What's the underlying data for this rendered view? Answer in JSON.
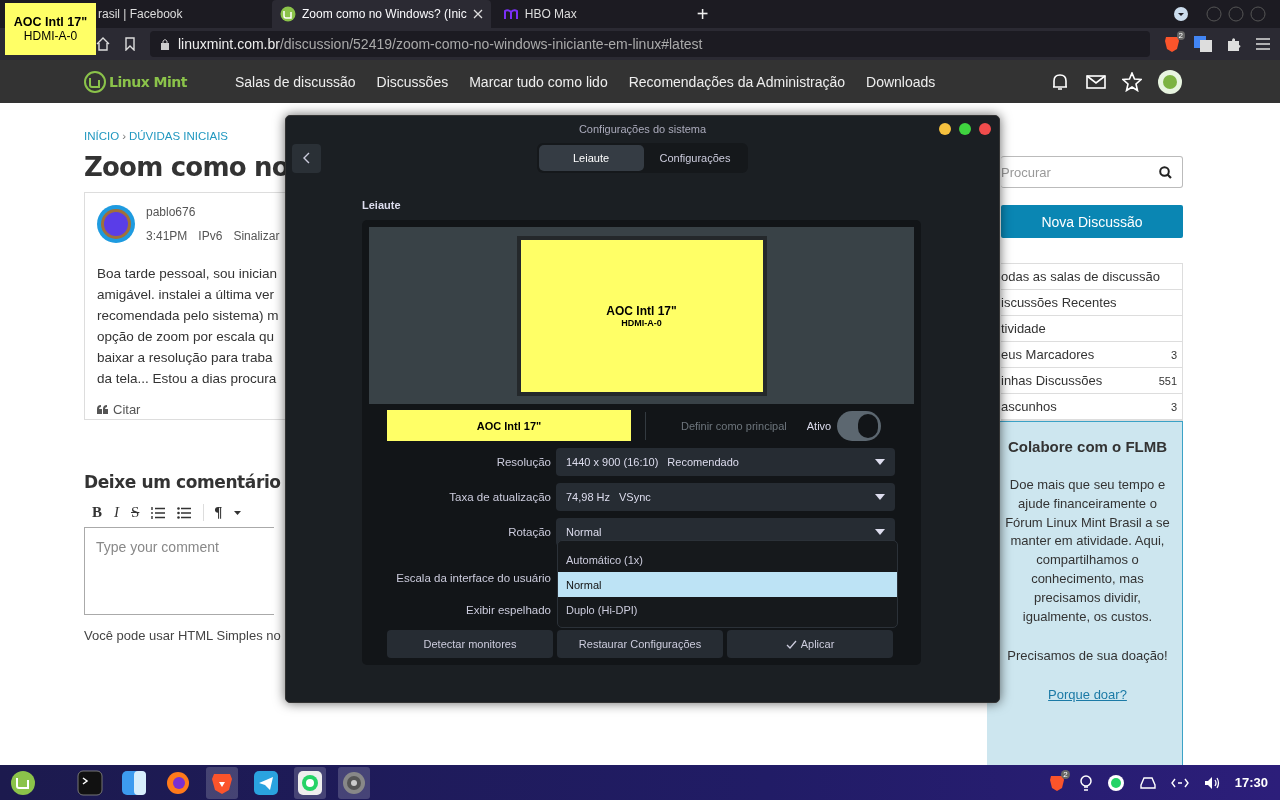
{
  "browser": {
    "tabs": [
      {
        "title": "rasil | Facebook",
        "kind": "plain",
        "selected": false
      },
      {
        "title": "Zoom como no Windows? (Inic",
        "kind": "mint",
        "selected": true
      },
      {
        "title": "HBO Max",
        "kind": "hbo",
        "selected": false
      }
    ],
    "new_tab": "+",
    "url_host": "linuxmint.com.br",
    "url_path": "/discussion/52419/zoom-como-no-windows-iniciante-em-linux#latest",
    "shield_count": "2"
  },
  "monitor_tooltip": {
    "name": "AOC Intl 17\"",
    "connector": "HDMI-A-0"
  },
  "site": {
    "logo_text": "Linux Mint",
    "nav": [
      "Salas de discussão",
      "Discussões",
      "Marcar tudo como lido",
      "Recomendações da Administração",
      "Downloads"
    ],
    "breadcrumbs": [
      "INÍCIO",
      "DÚVIDAS INICIAIS"
    ],
    "breadcrumb_separator": "›",
    "title": "Zoom como no",
    "post": {
      "author": "pablo676",
      "time": "3:41PM",
      "ip": "IPv6",
      "flag": "Sinalizar",
      "lines": [
        "Boa tarde pessoal, sou inician",
        "amigável. instalei a última ver",
        "recomendada pelo sistema) m",
        "opção de zoom por escala qu",
        "baixar a resolução para traba",
        "da tela... Estou a dias procura"
      ],
      "quote": "Citar"
    },
    "comment": {
      "heading": "Deixe um comentário",
      "toolbar": [
        "B",
        "I",
        "S",
        "¶"
      ],
      "placeholder": "Type your comment",
      "note": "Você pode usar HTML Simples no"
    },
    "sidebar": {
      "search_placeholder": "Procurar",
      "new_button": "Nova Discussão",
      "links": [
        {
          "label": "odas as salas de discussão"
        },
        {
          "label": "iscussões Recentes"
        },
        {
          "label": "tividade"
        },
        {
          "label": "eus Marcadores",
          "count": "3"
        },
        {
          "label": "inhas Discussões",
          "count": "551"
        },
        {
          "label": "ascunhos",
          "count": "3"
        }
      ],
      "donate": {
        "title": "Colabore com o FLMB",
        "text": "Doe mais que seu tempo e ajude financeiramente o Fórum Linux Mint Brasil a se manter em atividade. Aqui, compartilhamos o conhecimento, mas precisamos dividir, igualmente, os custos.",
        "appeal": "Precisamos de sua doação!",
        "link": "Porque doar?"
      }
    }
  },
  "dialog": {
    "title": "Configurações do sistema",
    "tabs": [
      {
        "label": "Leiaute",
        "selected": true
      },
      {
        "label": "Configurações",
        "selected": false
      }
    ],
    "section": "Leiaute",
    "monitor": {
      "name": "AOC Intl 17\"",
      "connector": "HDMI-A-0"
    },
    "name_chip": "AOC Intl 17\"",
    "primary_label": "Definir como principal",
    "active_label": "Ativo",
    "active_on": true,
    "rows": [
      {
        "label": "Resolução",
        "kind": "dropdown",
        "value": "1440 x 900 (16:10)",
        "note": "Recomendado"
      },
      {
        "label": "Taxa de atualização",
        "kind": "dropdown",
        "value": "74,98 Hz",
        "note": "VSync"
      },
      {
        "label": "Rotação",
        "kind": "dropdown",
        "value": "Normal"
      },
      {
        "label": "Escala da interface do usuário",
        "kind": "covered"
      },
      {
        "label": "Exibir espelhado",
        "kind": "covered"
      }
    ],
    "popup": [
      {
        "label": "Automático (1x)",
        "selected": false
      },
      {
        "label": "Normal",
        "selected": true
      },
      {
        "label": "Duplo (Hi-DPI)",
        "selected": false
      }
    ],
    "buttons": [
      {
        "label": "Detectar monitores",
        "kind": "plain"
      },
      {
        "label": "Restaurar Configurações",
        "kind": "plain"
      },
      {
        "label": "Aplicar",
        "kind": "check"
      }
    ]
  },
  "taskbar": {
    "apps": [
      {
        "kind": "terminal",
        "running": false
      },
      {
        "kind": "finder",
        "running": false
      },
      {
        "kind": "firefox",
        "running": false
      },
      {
        "kind": "brave",
        "running": true
      },
      {
        "kind": "telegram",
        "running": false
      },
      {
        "kind": "whatsapp",
        "running": true
      },
      {
        "kind": "settings",
        "running": true
      }
    ],
    "tray_badge": "2",
    "clock": "17:30"
  }
}
